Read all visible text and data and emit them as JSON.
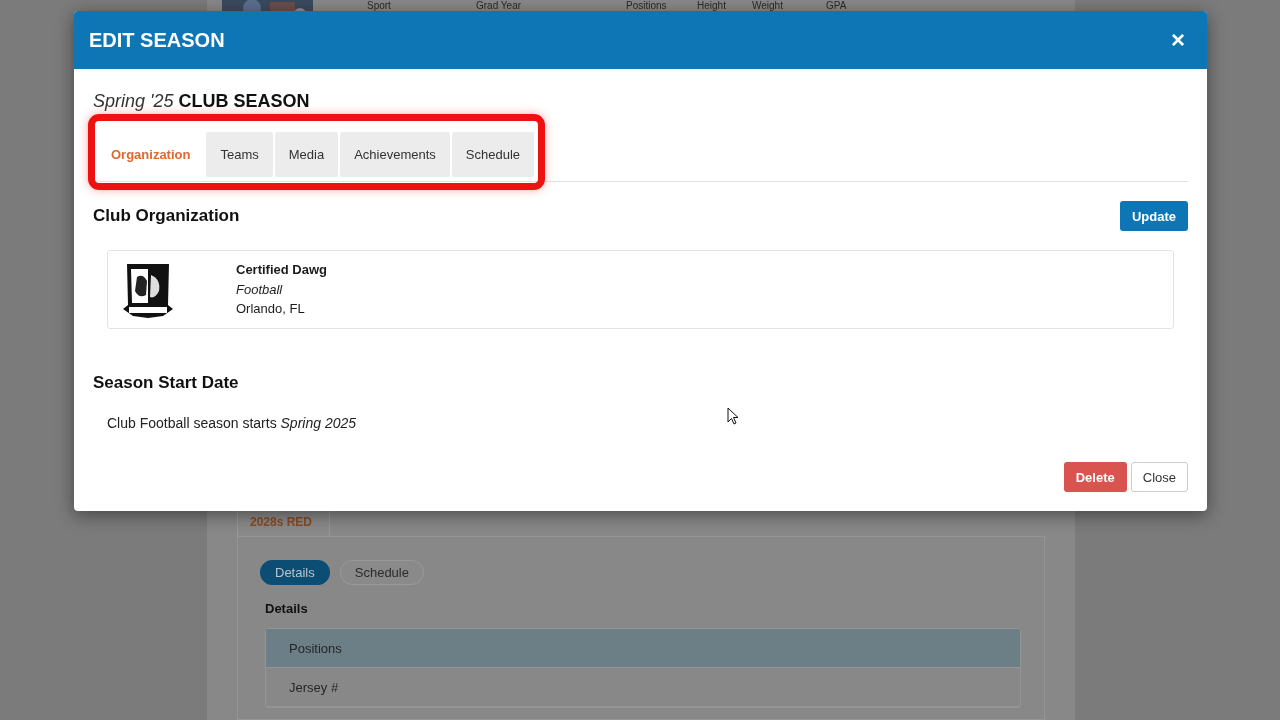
{
  "background_page": {
    "header_columns": [
      "Sport",
      "Grad Year",
      "Positions",
      "Height",
      "Weight",
      "GPA"
    ],
    "team_tab": "2028s RED",
    "pills": [
      {
        "label": "Details",
        "selected": true
      },
      {
        "label": "Schedule",
        "selected": false
      }
    ],
    "section_title": "Details",
    "rows": [
      {
        "label": "Positions",
        "selected": true
      },
      {
        "label": "Jersey #",
        "selected": false
      }
    ]
  },
  "modal": {
    "title": "EDIT SEASON",
    "close": "×",
    "season": "Spring '25",
    "season_type": "CLUB SEASON",
    "tabs": [
      {
        "label": "Organization",
        "selected": true
      },
      {
        "label": "Teams",
        "selected": false
      },
      {
        "label": "Media",
        "selected": false
      },
      {
        "label": "Achievements",
        "selected": false
      },
      {
        "label": "Schedule",
        "selected": false
      }
    ],
    "section_title": "Club Organization",
    "update_button": "Update",
    "organization": {
      "name": "Certified Dawg",
      "sport": "Football",
      "location": "Orlando, FL"
    },
    "start_date": {
      "title": "Season Start Date",
      "text": "Club Football season starts *Spring 2025*"
    },
    "buttons": [
      {
        "label": "Delete",
        "kind": "danger"
      },
      {
        "label": "Close",
        "kind": "default"
      }
    ]
  }
}
